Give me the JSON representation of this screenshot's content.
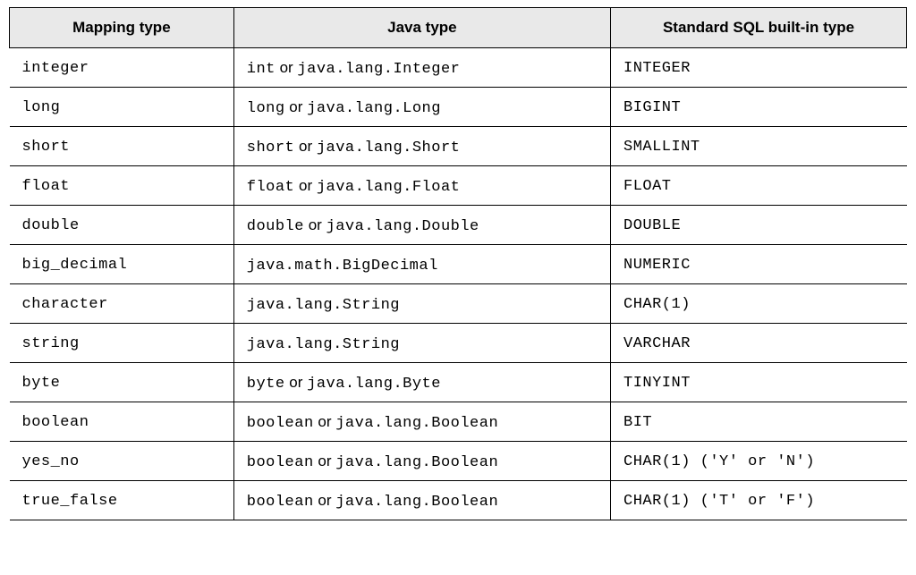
{
  "table": {
    "headers": {
      "mapping": "Mapping type",
      "java": "Java type",
      "sql": "Standard SQL built-in type"
    },
    "or_text": " or ",
    "rows": [
      {
        "mapping": "integer",
        "java_a": "int",
        "java_b": "java.lang.Integer",
        "sql": "INTEGER"
      },
      {
        "mapping": "long",
        "java_a": "long",
        "java_b": "java.lang.Long",
        "sql": "BIGINT"
      },
      {
        "mapping": "short",
        "java_a": "short",
        "java_b": "java.lang.Short",
        "sql": "SMALLINT"
      },
      {
        "mapping": "float",
        "java_a": "float",
        "java_b": "java.lang.Float",
        "sql": "FLOAT"
      },
      {
        "mapping": "double",
        "java_a": "double",
        "java_b": "java.lang.Double",
        "sql": "DOUBLE"
      },
      {
        "mapping": "big_decimal",
        "java_a": "java.math.BigDecimal",
        "java_b": "",
        "sql": "NUMERIC"
      },
      {
        "mapping": "character",
        "java_a": "java.lang.String",
        "java_b": "",
        "sql": "CHAR(1)"
      },
      {
        "mapping": "string",
        "java_a": "java.lang.String",
        "java_b": "",
        "sql": "VARCHAR"
      },
      {
        "mapping": "byte",
        "java_a": "byte",
        "java_b": "java.lang.Byte",
        "sql": "TINYINT"
      },
      {
        "mapping": "boolean",
        "java_a": "boolean",
        "java_b": "java.lang.Boolean",
        "sql": "BIT"
      },
      {
        "mapping": "yes_no",
        "java_a": "boolean",
        "java_b": "java.lang.Boolean",
        "sql": "CHAR(1) ('Y' or 'N')"
      },
      {
        "mapping": "true_false",
        "java_a": "boolean",
        "java_b": "java.lang.Boolean",
        "sql": "CHAR(1) ('T' or 'F')"
      }
    ]
  }
}
